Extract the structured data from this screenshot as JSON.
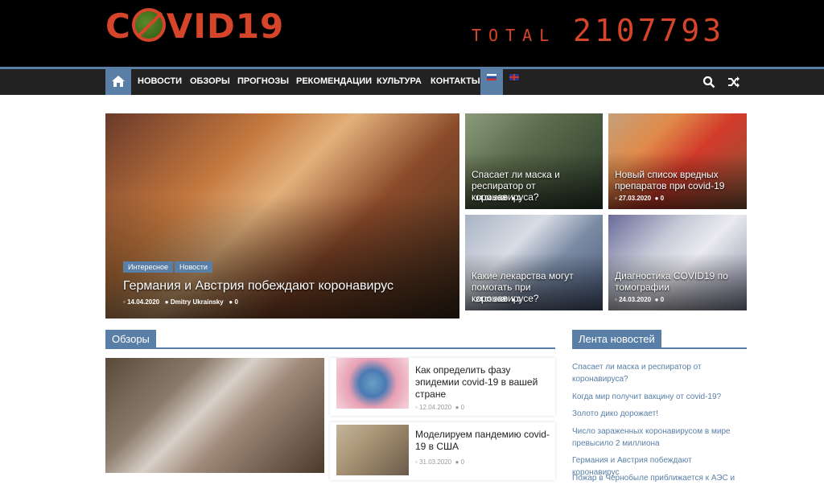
{
  "header": {
    "logo_text_before": "C",
    "logo_text_after": "VID19",
    "total_label": "TOTAL",
    "total_value": "2107793"
  },
  "nav": {
    "items": [
      "НОВОСТИ",
      "ОБЗОРЫ",
      "ПРОГНОЗЫ",
      "РЕКОМЕНДАЦИИ",
      "КУЛЬТУРА",
      "КОНТАКТЫ"
    ]
  },
  "featured": {
    "main": {
      "tags": [
        "Интересное",
        "Новости"
      ],
      "title": "Германия и Австрия побеждают коронавирус",
      "date": "14.04.2020",
      "author": "Dmitry Ukrainsky",
      "comments": "0"
    },
    "side": [
      {
        "title": "Спасает ли маска и респиратор от коронавируса?",
        "date": "14.04.2020",
        "comments": "0"
      },
      {
        "title": "Новый список вредных препаратов при covid-19",
        "date": "27.03.2020",
        "comments": "0"
      },
      {
        "title": "Какие лекарства могут помогать при коронавирусе?",
        "date": "24.03.2020",
        "comments": "0"
      },
      {
        "title": "Диагностика COVID19 по томографии",
        "date": "24.03.2020",
        "comments": "0"
      }
    ]
  },
  "reviews": {
    "heading": "Обзоры",
    "cards": [
      {
        "title": "Как определить фазу эпидемии covid-19 в вашей стране",
        "date": "12.04.2020",
        "comments": "0"
      },
      {
        "title": "Моделируем пандемию covid-19 в США",
        "date": "31.03.2020",
        "comments": "0"
      }
    ]
  },
  "news_feed": {
    "heading": "Лента новостей",
    "items": [
      "Спасает ли маска и респиратор от коронавируса?",
      "Когда мир получит вакцину от covid-19?",
      "Золото дико дорожает!",
      "Число зараженных коронавирусом в мире превысило 2 миллиона",
      "Германия и Австрия побеждают коронавирус",
      "Пожар в Чернобыле приближается к АЭС и"
    ]
  },
  "colors": {
    "accent": "#5a7fa6",
    "logo": "#d6442a",
    "nav_bg": "#222222"
  }
}
